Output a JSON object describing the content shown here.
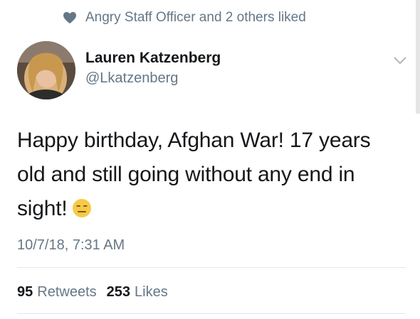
{
  "social_context": {
    "text": "Angry Staff Officer and 2 others liked",
    "icon": "heart-icon"
  },
  "author": {
    "name": "Lauren Katzenberg",
    "handle": "@Lkatzenberg"
  },
  "tweet": {
    "text": "Happy birthday, Afghan War! 17 years old and still going without any end in sight!",
    "emoji": "expressionless-face-emoji",
    "timestamp": "10/7/18, 7:31 AM"
  },
  "stats": {
    "retweets_count": "95",
    "retweets_label": "Retweets",
    "likes_count": "253",
    "likes_label": "Likes"
  },
  "colors": {
    "text_primary": "#14171a",
    "text_secondary": "#657786",
    "divider": "#e1e8ed",
    "emoji_yellow": "#f7c948"
  }
}
